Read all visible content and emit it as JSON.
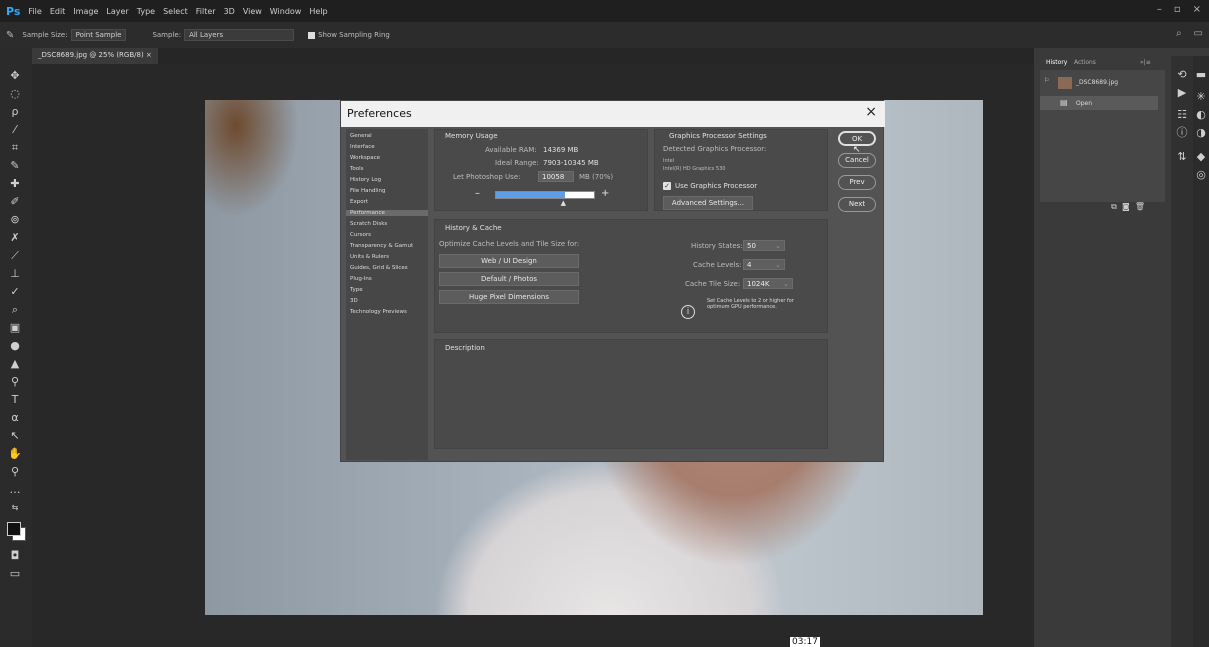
{
  "app": {
    "logo": "Ps",
    "menu": [
      "File",
      "Edit",
      "Image",
      "Layer",
      "Type",
      "Select",
      "Filter",
      "3D",
      "View",
      "Window",
      "Help"
    ],
    "window_controls": [
      "–",
      "▫",
      "×"
    ]
  },
  "options_bar": {
    "sample_size_label": "Sample Size:",
    "sample_size_value": "Point Sample",
    "sample_label": "Sample:",
    "sample_value": "All Layers",
    "show_ring_label": "Show Sampling Ring"
  },
  "document_tab": "_DSC8689.jpg @ 25% (RGB/8) ×",
  "history_panel": {
    "tabs": [
      "History",
      "Actions"
    ],
    "snapshot_name": "_DSC8689.jpg",
    "step": "Open"
  },
  "dialog": {
    "title": "Preferences",
    "close": "×",
    "categories": [
      "General",
      "Interface",
      "Workspace",
      "Tools",
      "History Log",
      "File Handling",
      "Export",
      "Performance",
      "Scratch Disks",
      "Cursors",
      "Transparency & Gamut",
      "Units & Rulers",
      "Guides, Grid & Slices",
      "Plug-Ins",
      "Type",
      "3D",
      "Technology Previews"
    ],
    "selected_category": "Performance",
    "memory": {
      "title": "Memory Usage",
      "available_label": "Available RAM:",
      "available_value": "14369 MB",
      "ideal_label": "Ideal Range:",
      "ideal_value": "7903-10345 MB",
      "let_label": "Let Photoshop Use:",
      "let_value": "10058",
      "let_unit": "MB (70%)",
      "slider_fraction": 0.7,
      "minus": "–",
      "plus": "+"
    },
    "gpu": {
      "title": "Graphics Processor Settings",
      "detected_label": "Detected Graphics Processor:",
      "vendor": "Intel",
      "device": "Intel(R) HD Graphics 530",
      "use_gpu_label": "Use Graphics Processor",
      "advanced_button": "Advanced Settings..."
    },
    "history_cache": {
      "title": "History & Cache",
      "optimize_label": "Optimize Cache Levels and Tile Size for:",
      "btn_web": "Web / UI Design",
      "btn_default": "Default / Photos",
      "btn_huge": "Huge Pixel Dimensions",
      "states_label": "History States:",
      "states_value": "50",
      "levels_label": "Cache Levels:",
      "levels_value": "4",
      "tile_label": "Cache Tile Size:",
      "tile_value": "1024K",
      "note": "Set Cache Levels to 2 or higher for optimum GPU performance."
    },
    "description": {
      "title": "Description"
    },
    "buttons": {
      "ok": "OK",
      "cancel": "Cancel",
      "prev": "Prev",
      "next": "Next"
    }
  },
  "timestamp": "03:17"
}
